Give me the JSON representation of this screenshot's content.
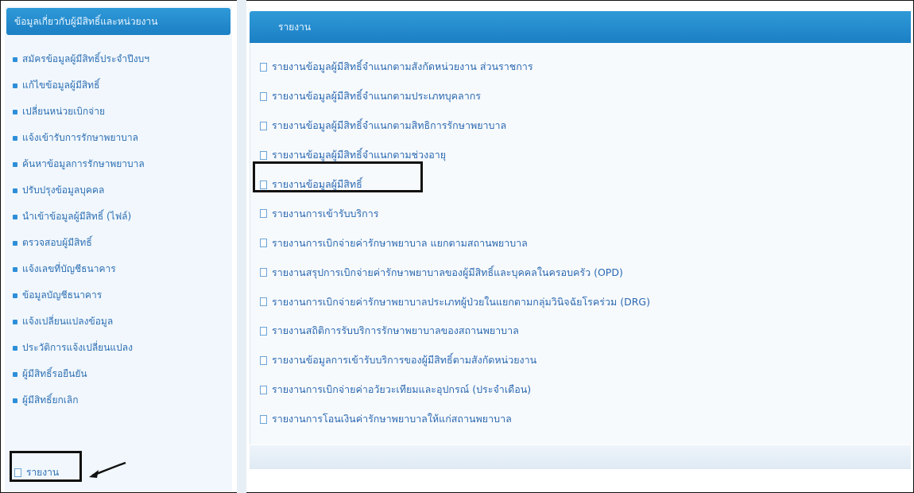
{
  "sidebar": {
    "header": "ข้อมูลเกี่ยวกับผู้มีสิทธิ์และหน่วยงาน",
    "items": [
      {
        "label": "สมัครข้อมูลผู้มีสิทธิ์ประจำปีงบฯ"
      },
      {
        "label": "แก้ไขข้อมูลผู้มีสิทธิ์"
      },
      {
        "label": "เปลี่ยนหน่วยเบิกจ่าย"
      },
      {
        "label": "แจ้งเข้ารับการรักษาพยาบาล"
      },
      {
        "label": "ค้นหาข้อมูลการรักษาพยาบาล"
      },
      {
        "label": "ปรับปรุงข้อมูลบุคคล"
      },
      {
        "label": "นำเข้าข้อมูลผู้มีสิทธิ์ (ไฟล์)"
      },
      {
        "label": "ตรวจสอบผู้มีสิทธิ์"
      },
      {
        "label": "แจ้งเลขที่บัญชีธนาคาร"
      },
      {
        "label": "ข้อมูลบัญชีธนาคาร"
      },
      {
        "label": "แจ้งเปลี่ยนแปลงข้อมูล"
      },
      {
        "label": "ประวัติการแจ้งเปลี่ยนแปลง"
      },
      {
        "label": "ผู้มีสิทธิ์รอยืนยัน"
      },
      {
        "label": "ผู้มีสิทธิ์ยกเลิก"
      }
    ],
    "last_item": "รายงาน"
  },
  "main": {
    "header": "รายงาน",
    "reports": [
      "รายงานข้อมูลผู้มีสิทธิ์จำแนกตามสังกัดหน่วยงาน ส่วนราชการ",
      "รายงานข้อมูลผู้มีสิทธิ์จำแนกตามประเภทบุคลากร",
      "รายงานข้อมูลผู้มีสิทธิ์จำแนกตามสิทธิการรักษาพยาบาล",
      "รายงานข้อมูลผู้มีสิทธิ์จำแนกตามช่วงอายุ",
      "รายงานข้อมูลผู้มีสิทธิ์",
      "รายงานการเข้ารับบริการ",
      "รายงานการเบิกจ่ายค่ารักษาพยาบาล แยกตามสถานพยาบาล",
      "รายงานสรุปการเบิกจ่ายค่ารักษาพยาบาลของผู้มีสิทธิ์และบุคคลในครอบครัว (OPD)",
      "รายงานการเบิกจ่ายค่ารักษาพยาบาลประเภทผู้ป่วยในแยกตามกลุ่มวินิจฉัยโรคร่วม (DRG)",
      "รายงานสถิติการรับบริการรักษาพยาบาลของสถานพยาบาล",
      "รายงานข้อมูลการเข้ารับบริการของผู้มีสิทธิ์ตามสังกัดหน่วยงาน",
      "รายงานการเบิกจ่ายค่าอวัยวะเทียมและอุปกรณ์ (ประจำเดือน)",
      "รายงานการโอนเงินค่ารักษาพยาบาลให้แก่สถานพยาบาล"
    ]
  },
  "colors": {
    "header_blue": "#1c7fc4",
    "link_blue": "#2a68b0",
    "panel_bg": "#f1f7fc"
  }
}
